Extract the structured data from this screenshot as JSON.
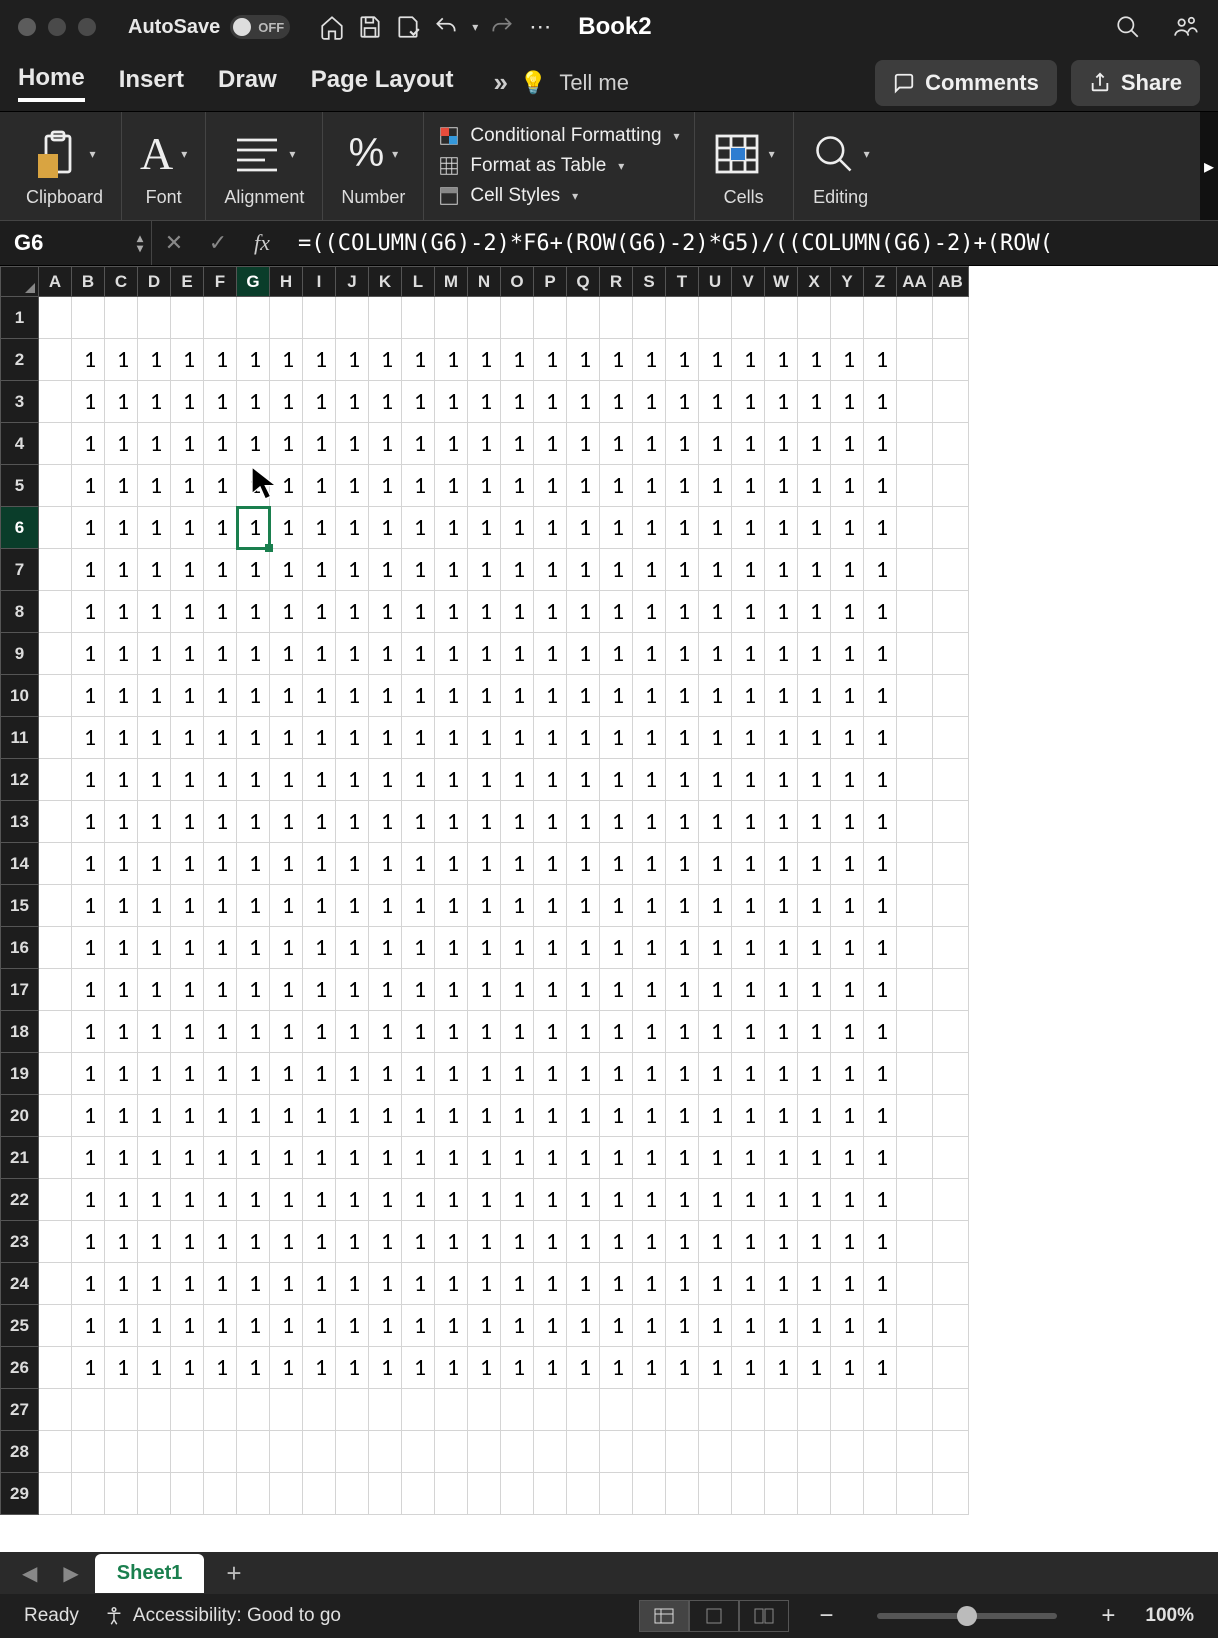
{
  "titlebar": {
    "autosave_label": "AutoSave",
    "autosave_state": "OFF",
    "document_title": "Book2"
  },
  "tabs": {
    "items": [
      "Home",
      "Insert",
      "Draw",
      "Page Layout"
    ],
    "active": "Home",
    "tellme": "Tell me"
  },
  "ribbon_buttons": {
    "comments": "Comments",
    "share": "Share"
  },
  "ribbon_groups": {
    "clipboard": "Clipboard",
    "font": "Font",
    "alignment": "Alignment",
    "number": "Number",
    "cells": "Cells",
    "editing": "Editing",
    "conditional_formatting": "Conditional Formatting",
    "format_as_table": "Format as Table",
    "cell_styles": "Cell Styles"
  },
  "formula_bar": {
    "cell_ref": "G6",
    "formula": "=((COLUMN(G6)-2)*F6+(ROW(G6)-2)*G5)/((COLUMN(G6)-2)+(ROW("
  },
  "grid": {
    "columns": [
      "A",
      "B",
      "C",
      "D",
      "E",
      "F",
      "G",
      "H",
      "I",
      "J",
      "K",
      "L",
      "M",
      "N",
      "O",
      "P",
      "Q",
      "R",
      "S",
      "T",
      "U",
      "V",
      "W",
      "X",
      "Y",
      "Z",
      "AA",
      "AB"
    ],
    "selected_col_index": 6,
    "row_count": 29,
    "selected_row": 6,
    "data_row_start": 2,
    "data_row_end": 26,
    "data_col_start": 1,
    "data_col_end": 25,
    "cell_value": "1",
    "selected_cell": "G6"
  },
  "sheet_tabs": {
    "active": "Sheet1"
  },
  "status_bar": {
    "state": "Ready",
    "accessibility": "Accessibility: Good to go",
    "zoom": "100%"
  }
}
